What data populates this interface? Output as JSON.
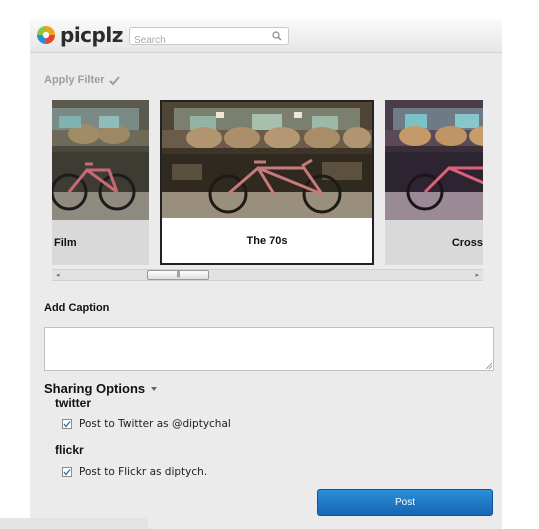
{
  "header": {
    "brand": "picplz",
    "search_placeholder": "Search"
  },
  "filters": {
    "heading": "Apply Filter",
    "items": [
      {
        "label": "Film",
        "selected": false
      },
      {
        "label": "The 70s",
        "selected": true
      },
      {
        "label": "Cross",
        "selected": false
      }
    ]
  },
  "caption": {
    "heading": "Add Caption",
    "value": ""
  },
  "sharing": {
    "heading": "Sharing Options",
    "services": [
      {
        "name": "twitter",
        "option_label": "Post to Twitter as @diptychal",
        "checked": true
      },
      {
        "name": "flickr",
        "option_label": "Post to Flickr as diptych.",
        "checked": true
      }
    ]
  },
  "actions": {
    "post_label": "Post"
  },
  "colors": {
    "accent": "#1e7bc8",
    "panel": "#ebebeb"
  }
}
